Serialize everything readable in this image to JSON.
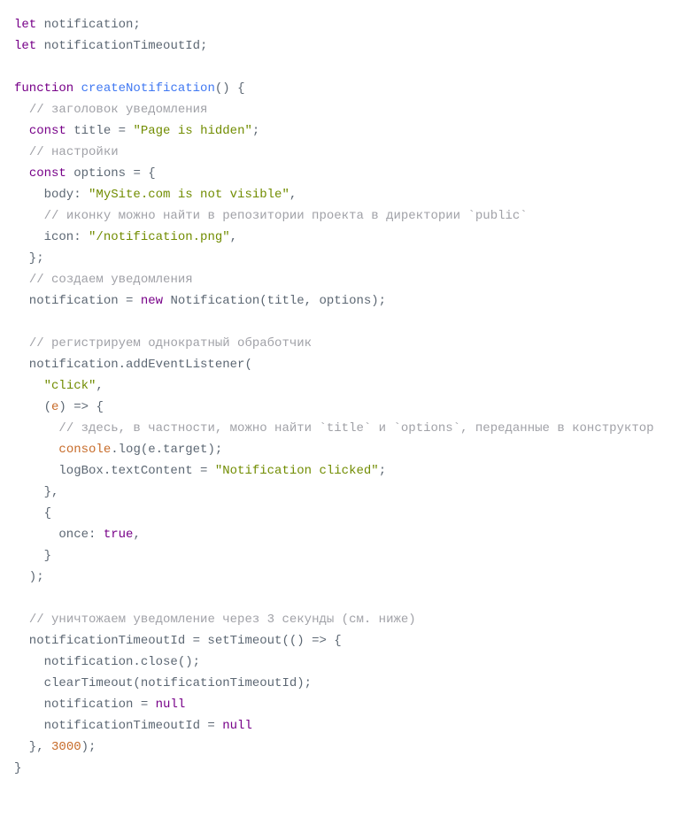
{
  "code": {
    "lines": [
      [
        [
          "kw",
          "let"
        ],
        [
          "p",
          " notification;"
        ]
      ],
      [
        [
          "kw",
          "let"
        ],
        [
          "p",
          " notificationTimeoutId;"
        ]
      ],
      [
        [
          "p",
          ""
        ]
      ],
      [
        [
          "kw",
          "function"
        ],
        [
          "p",
          " "
        ],
        [
          "fn",
          "createNotification"
        ],
        [
          "p",
          "() {"
        ]
      ],
      [
        [
          "p",
          "  "
        ],
        [
          "com",
          "// заголовок уведомления"
        ]
      ],
      [
        [
          "p",
          "  "
        ],
        [
          "kw",
          "const"
        ],
        [
          "p",
          " title = "
        ],
        [
          "str",
          "\"Page is hidden\""
        ],
        [
          "p",
          ";"
        ]
      ],
      [
        [
          "p",
          "  "
        ],
        [
          "com",
          "// настройки"
        ]
      ],
      [
        [
          "p",
          "  "
        ],
        [
          "kw",
          "const"
        ],
        [
          "p",
          " options = {"
        ]
      ],
      [
        [
          "p",
          "    body: "
        ],
        [
          "str",
          "\"MySite.com is not visible\""
        ],
        [
          "p",
          ","
        ]
      ],
      [
        [
          "p",
          "    "
        ],
        [
          "com",
          "// иконку можно найти в репозитории проекта в директории `public`"
        ]
      ],
      [
        [
          "p",
          "    icon: "
        ],
        [
          "str",
          "\"/notification.png\""
        ],
        [
          "p",
          ","
        ]
      ],
      [
        [
          "p",
          "  };"
        ]
      ],
      [
        [
          "p",
          "  "
        ],
        [
          "com",
          "// создаем уведомления"
        ]
      ],
      [
        [
          "p",
          "  notification = "
        ],
        [
          "kw",
          "new"
        ],
        [
          "p",
          " Notification(title, options);"
        ]
      ],
      [
        [
          "p",
          ""
        ]
      ],
      [
        [
          "p",
          "  "
        ],
        [
          "com",
          "// регистрируем однократный обработчик"
        ]
      ],
      [
        [
          "p",
          "  notification.addEventListener("
        ]
      ],
      [
        [
          "p",
          "    "
        ],
        [
          "str",
          "\"click\""
        ],
        [
          "p",
          ","
        ]
      ],
      [
        [
          "p",
          "    ("
        ],
        [
          "num",
          "e"
        ],
        [
          "p",
          ") "
        ],
        [
          "p",
          "=>"
        ],
        [
          "p",
          " {"
        ]
      ],
      [
        [
          "p",
          "      "
        ],
        [
          "com",
          "// здесь, в частности, можно найти `title` и `options`, переданные в конструктор"
        ]
      ],
      [
        [
          "p",
          "      "
        ],
        [
          "num",
          "console"
        ],
        [
          "p",
          ".log(e.target);"
        ]
      ],
      [
        [
          "p",
          "      logBox.textContent = "
        ],
        [
          "str",
          "\"Notification clicked\""
        ],
        [
          "p",
          ";"
        ]
      ],
      [
        [
          "p",
          "    },"
        ]
      ],
      [
        [
          "p",
          "    {"
        ]
      ],
      [
        [
          "p",
          "      once: "
        ],
        [
          "kw",
          "true"
        ],
        [
          "p",
          ","
        ]
      ],
      [
        [
          "p",
          "    }"
        ]
      ],
      [
        [
          "p",
          "  );"
        ]
      ],
      [
        [
          "p",
          ""
        ]
      ],
      [
        [
          "p",
          "  "
        ],
        [
          "com",
          "// уничтожаем уведомление через 3 секунды (см. ниже)"
        ]
      ],
      [
        [
          "p",
          "  notificationTimeoutId = setTimeout(("
        ],
        [
          "num",
          ""
        ],
        [
          "p",
          ") "
        ],
        [
          "p",
          "=>"
        ],
        [
          "p",
          " {"
        ]
      ],
      [
        [
          "p",
          "    notification.close();"
        ]
      ],
      [
        [
          "p",
          "    clearTimeout(notificationTimeoutId);"
        ]
      ],
      [
        [
          "p",
          "    notification = "
        ],
        [
          "kw",
          "null"
        ]
      ],
      [
        [
          "p",
          "    notificationTimeoutId = "
        ],
        [
          "kw",
          "null"
        ]
      ],
      [
        [
          "p",
          "  }, "
        ],
        [
          "num",
          "3000"
        ],
        [
          "p",
          ");"
        ]
      ],
      [
        [
          "p",
          "}"
        ]
      ]
    ]
  }
}
